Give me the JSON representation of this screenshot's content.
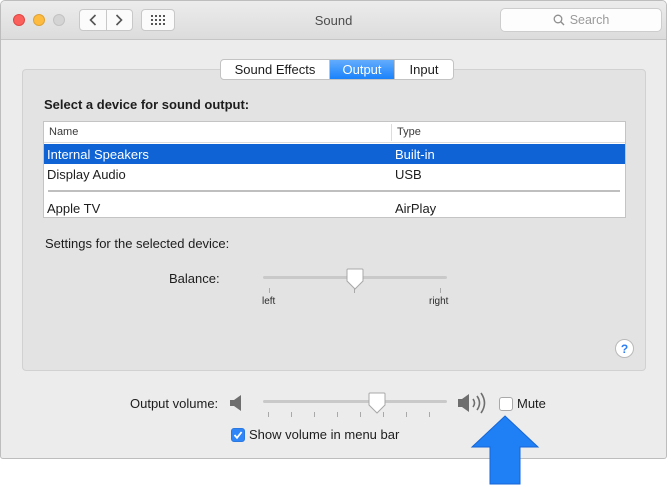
{
  "window": {
    "title": "Sound"
  },
  "search": {
    "placeholder": "Search"
  },
  "tabs": [
    {
      "label": "Sound Effects",
      "active": false
    },
    {
      "label": "Output",
      "active": true
    },
    {
      "label": "Input",
      "active": false
    }
  ],
  "device_heading": "Select a device for sound output:",
  "device_table": {
    "columns": [
      "Name",
      "Type"
    ],
    "rows": [
      {
        "name": "Internal Speakers",
        "type": "Built-in",
        "selected": true
      },
      {
        "name": "Display Audio",
        "type": "USB",
        "selected": false
      },
      {
        "name": "Apple TV",
        "type": "AirPlay",
        "selected": false
      }
    ]
  },
  "settings_label": "Settings for the selected device:",
  "balance": {
    "label": "Balance:",
    "left_label": "left",
    "right_label": "right",
    "value": 0.5
  },
  "output_volume": {
    "label": "Output volume:",
    "value": 0.62
  },
  "mute": {
    "label": "Mute",
    "checked": false
  },
  "show_volume": {
    "label": "Show volume in menu bar",
    "checked": true
  },
  "colors": {
    "accent": "#1a82fb",
    "selection": "#0f63d5",
    "callout_arrow": "#1f7ff5"
  },
  "icons": [
    "back-chevron-icon",
    "forward-chevron-icon",
    "grid-icon",
    "search-icon",
    "speaker-low-icon",
    "speaker-high-icon",
    "checkmark-icon",
    "arrow-up-icon"
  ]
}
